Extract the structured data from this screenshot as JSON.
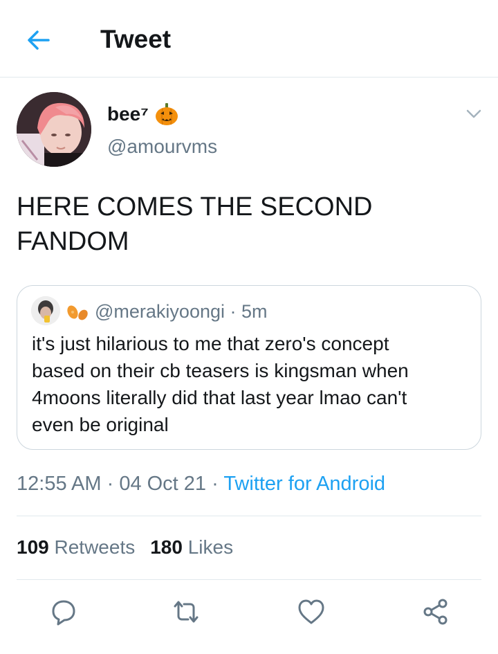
{
  "header": {
    "title": "Tweet",
    "back_icon": "arrow-left-icon"
  },
  "author": {
    "name": "bee⁷",
    "emoji": "jack-o-lantern",
    "handle": "@amourvms"
  },
  "tweet": {
    "text": "HERE COMES THE SECOND\nFANDOM"
  },
  "quoted": {
    "emoji": "sweet-potato",
    "handle": "@merakiyoongi",
    "separator": " · ",
    "time": "5m",
    "text": "it's just hilarious to me that zero's concept\nbased on their cb teasers is kingsman when\n4moons literally did that last year lmao can't\neven be original"
  },
  "meta": {
    "time": "12:55 AM",
    "date": "04 Oct 21",
    "separator": " · ",
    "source": "Twitter for Android"
  },
  "stats": {
    "retweets_count": "109",
    "retweets_label": "Retweets",
    "likes_count": "180",
    "likes_label": "Likes"
  },
  "colors": {
    "accent": "#1da1f2",
    "secondary_text": "#657786",
    "border": "#e1e8ed",
    "primary_text": "#14171a"
  },
  "actions": [
    "reply-icon",
    "retweet-icon",
    "like-icon",
    "share-icon"
  ]
}
